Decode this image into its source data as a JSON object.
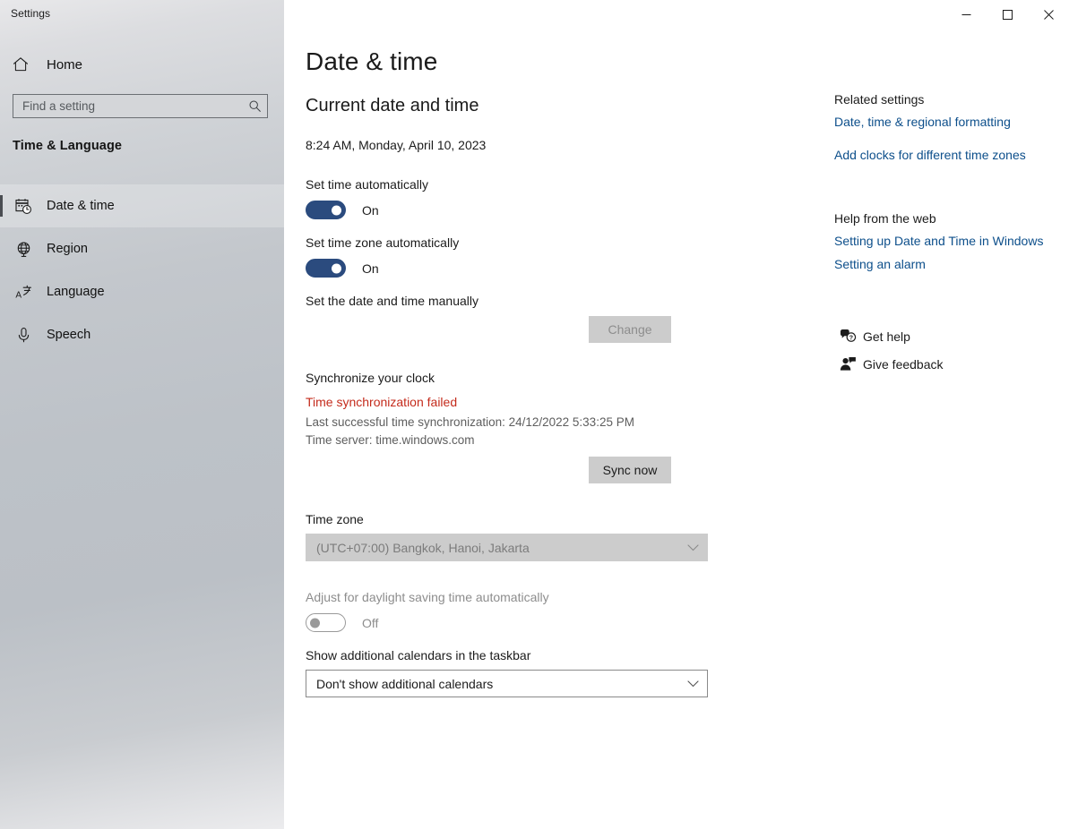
{
  "window": {
    "title": "Settings",
    "controls": {
      "minimize": "minimize-icon",
      "maximize": "maximize-icon",
      "close": "close-icon"
    }
  },
  "sidebar": {
    "home": {
      "label": "Home",
      "icon": "home-icon"
    },
    "search": {
      "placeholder": "Find a setting",
      "value": "",
      "icon": "search-icon"
    },
    "group_header": "Time & Language",
    "items": [
      {
        "label": "Date & time",
        "icon": "calendar-clock-icon",
        "selected": true
      },
      {
        "label": "Region",
        "icon": "globe-icon",
        "selected": false
      },
      {
        "label": "Language",
        "icon": "language-icon",
        "selected": false
      },
      {
        "label": "Speech",
        "icon": "microphone-icon",
        "selected": false
      }
    ]
  },
  "main": {
    "page_title": "Date & time",
    "section_heading": "Current date and time",
    "current_datetime": "8:24 AM, Monday, April 10, 2023",
    "set_time_auto": {
      "label": "Set time automatically",
      "state": "On",
      "on": true
    },
    "set_timezone_auto": {
      "label": "Set time zone automatically",
      "state": "On",
      "on": true
    },
    "set_manually": {
      "label": "Set the date and time manually",
      "button": "Change",
      "disabled": true
    },
    "sync": {
      "heading": "Synchronize your clock",
      "error": "Time synchronization failed",
      "last_sync": "Last successful time synchronization: 24/12/2022 5:33:25 PM",
      "server": "Time server: time.windows.com",
      "button": "Sync now"
    },
    "timezone": {
      "label": "Time zone",
      "value": "(UTC+07:00) Bangkok, Hanoi, Jakarta",
      "disabled": true,
      "chevron": "chevron-down-icon"
    },
    "dst": {
      "label": "Adjust for daylight saving time automatically",
      "state": "Off",
      "on": false,
      "disabled": true
    },
    "calendars": {
      "label": "Show additional calendars in the taskbar",
      "value": "Don't show additional calendars",
      "chevron": "chevron-down-icon"
    }
  },
  "right_panel": {
    "related_heading": "Related settings",
    "related_links": [
      "Date, time & regional formatting",
      "Add clocks for different time zones"
    ],
    "help_heading": "Help from the web",
    "help_links": [
      "Setting up Date and Time in Windows",
      "Setting an alarm"
    ],
    "support": [
      {
        "label": "Get help",
        "icon": "help-bubble-icon"
      },
      {
        "label": "Give feedback",
        "icon": "feedback-person-icon"
      }
    ]
  },
  "colors": {
    "accent_toggle": "#2b4b7e",
    "error": "#c42b1c",
    "link": "#0d4f8b",
    "button": "#cccccc"
  }
}
